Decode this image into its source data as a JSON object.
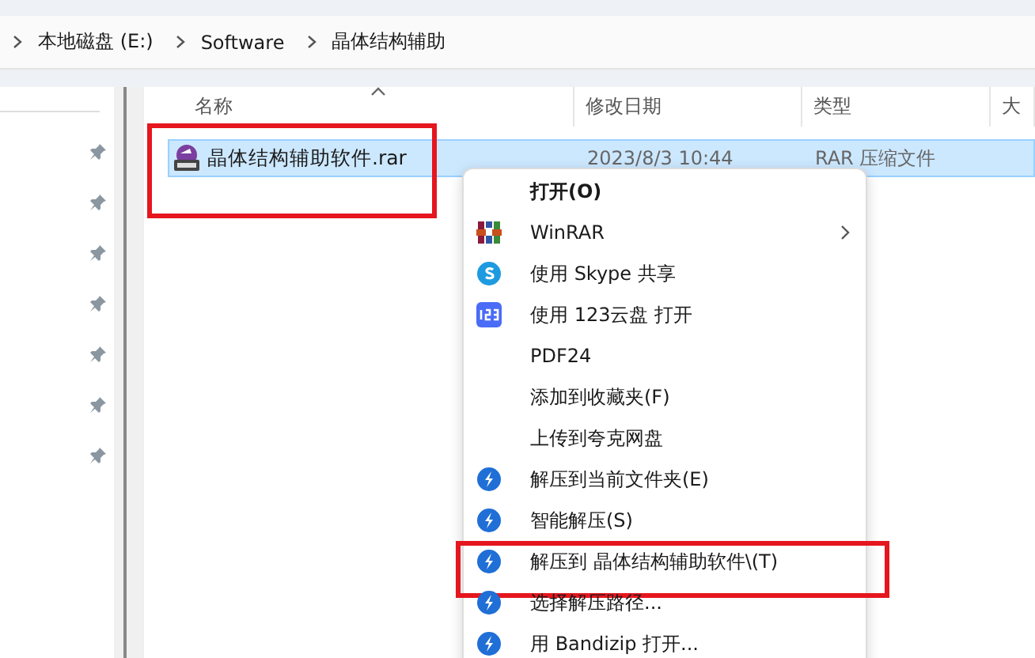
{
  "breadcrumb": [
    "本地磁盘 (E:)",
    "Software",
    "晶体结构辅助"
  ],
  "table": {
    "columns": [
      "名称",
      "修改日期",
      "类型",
      "大"
    ],
    "rows": [
      {
        "name": "晶体结构辅助软件.rar",
        "date": "2023/8/3 10:44",
        "type": "RAR 压缩文件",
        "selected": true,
        "highlighted": true
      }
    ]
  },
  "context_menu": [
    {
      "label": "打开(O)",
      "kind": "plain",
      "default": true,
      "submenu": false,
      "highlighted": false
    },
    {
      "label": "WinRAR",
      "kind": "winrar",
      "default": false,
      "submenu": true,
      "highlighted": false
    },
    {
      "label": "使用 Skype 共享",
      "kind": "skype",
      "default": false,
      "submenu": false,
      "highlighted": false
    },
    {
      "label": "使用 123云盘 打开",
      "kind": "cloud",
      "default": false,
      "submenu": false,
      "highlighted": false
    },
    {
      "label": "PDF24",
      "kind": "plain",
      "default": false,
      "submenu": false,
      "highlighted": false
    },
    {
      "label": "添加到收藏夹(F)",
      "kind": "plain",
      "default": false,
      "submenu": false,
      "highlighted": false
    },
    {
      "label": "上传到夸克网盘",
      "kind": "plain",
      "default": false,
      "submenu": false,
      "highlighted": false
    },
    {
      "label": "解压到当前文件夹(E)",
      "kind": "bandizip",
      "default": false,
      "submenu": false,
      "highlighted": false
    },
    {
      "label": "智能解压(S)",
      "kind": "bandizip",
      "default": false,
      "submenu": false,
      "highlighted": false
    },
    {
      "label": "解压到 晶体结构辅助软件\\(T)",
      "kind": "bandizip",
      "default": false,
      "submenu": false,
      "highlighted": true
    },
    {
      "label": "选择解压路径...",
      "kind": "bandizip",
      "default": false,
      "submenu": false,
      "highlighted": false
    },
    {
      "label": "用 Bandizip 打开...",
      "kind": "bandizip",
      "default": false,
      "submenu": false,
      "highlighted": false
    }
  ]
}
